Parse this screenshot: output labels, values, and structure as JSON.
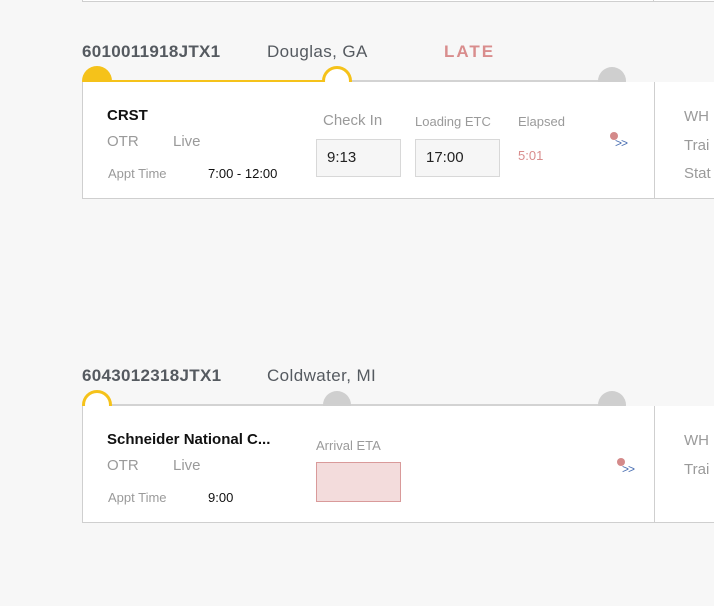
{
  "shipments": [
    {
      "id": "6010011918JTX1",
      "location": "Douglas, GA",
      "status": "LATE",
      "carrier": "CRST",
      "mode": "OTR",
      "load_type": "Live",
      "appt_label": "Appt Time",
      "appt_value": "7:00 - 12:00",
      "check_in_label": "Check In",
      "check_in_value": "9:13",
      "loading_etc_label": "Loading ETC",
      "loading_etc_value": "17:00",
      "elapsed_label": "Elapsed",
      "elapsed_value": "5:01",
      "expand_label": ">>",
      "side_labels": [
        "WH",
        "Trai",
        "Stat"
      ]
    },
    {
      "id": "6043012318JTX1",
      "location": "Coldwater, MI",
      "status": "",
      "carrier": "Schneider National C...",
      "mode": "OTR",
      "load_type": "Live",
      "appt_label": "Appt Time",
      "appt_value": "9:00",
      "arrival_eta_label": "Arrival ETA",
      "arrival_eta_value": "",
      "expand_label": ">>",
      "side_labels": [
        "WH",
        "Trai"
      ]
    }
  ],
  "colors": {
    "progress_active": "#f5c21a",
    "progress_inactive": "#cfcfcf",
    "late": "#d98d8d",
    "alert_dot": "#d48a8a",
    "expand_link": "#4a6fb3",
    "eta_box_fill": "#f3dcdc"
  },
  "icons": {
    "alert": "alert-dot-icon",
    "expand": "double-chevron-right-icon"
  }
}
